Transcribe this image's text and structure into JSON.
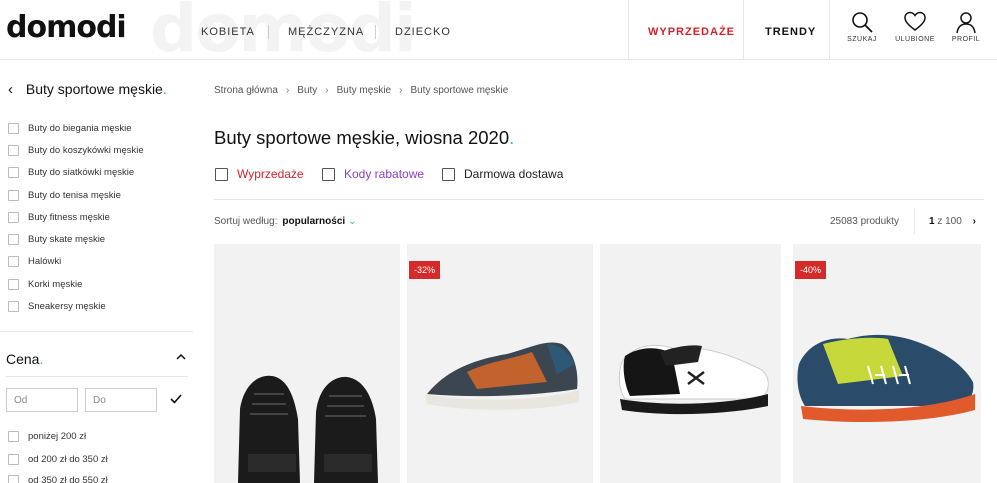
{
  "header": {
    "logo": "domodi",
    "nav": [
      "KOBIETA",
      "MĘŻCZYZNA",
      "DZIECKO"
    ],
    "sale_label": "WYPRZEDAŻE",
    "trends_label": "TRENDY",
    "icons": [
      {
        "label": "SZUKAJ",
        "icon": "search-icon"
      },
      {
        "label": "ULUBIONE",
        "icon": "heart-icon"
      },
      {
        "label": "PROFIL",
        "icon": "user-icon"
      }
    ],
    "sale_color": "#d2232a"
  },
  "sidebar": {
    "title": "Buty sportowe męskie",
    "categories": [
      "Buty do biegania męskie",
      "Buty do koszykówki męskie",
      "Buty do siatkówki męskie",
      "Buty do tenisa męskie",
      "Buty fitness męskie",
      "Buty skate męskie",
      "Halówki",
      "Korki męskie",
      "Sneakersy męskie"
    ],
    "price": {
      "title": "Cena",
      "from_placeholder": "Od",
      "to_placeholder": "Do",
      "ranges": [
        "poniżej 200 zł",
        "od 200 zł do 350 zł",
        "od 350 zł do 550 zł"
      ]
    }
  },
  "main": {
    "breadcrumbs": [
      "Strona główna",
      "Buty",
      "Buty męskie",
      "Buty sportowe męskie"
    ],
    "title": "Buty sportowe męskie, wiosna 2020",
    "filters": [
      {
        "label": "Wyprzedaże",
        "color": "#d2232a"
      },
      {
        "label": "Kody rabatowe",
        "color": "#8a3fc0"
      },
      {
        "label": "Darmowa dostawa",
        "color": "#222222"
      }
    ],
    "sort_label": "Sortuj według:",
    "sort_value": "popularności",
    "product_count": "25083 produkty",
    "page_current": "1",
    "page_of": "z 100",
    "accent_color": "#2bc0b4"
  },
  "products": [
    {
      "badge": "",
      "name": "black-sneaker"
    },
    {
      "badge": "-32%",
      "name": "puma-running-shoe"
    },
    {
      "badge": "",
      "name": "under-armour-shoe"
    },
    {
      "badge": "-40%",
      "name": "helly-hansen-shoe"
    }
  ]
}
